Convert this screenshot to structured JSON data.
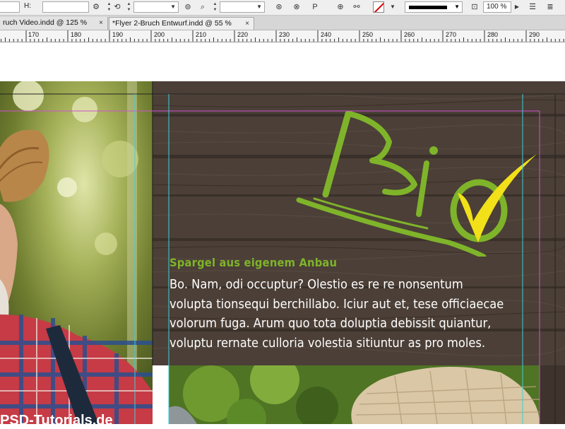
{
  "control_bar": {
    "height_label": "H:",
    "zoom_value": "100 %",
    "stroke_color": "#d40000"
  },
  "tabs": [
    {
      "label": "ruch Video.indd @ 125 %",
      "close": "×"
    },
    {
      "label": "*Flyer 2-Bruch Entwurf.indd @ 55 %",
      "close": "×"
    }
  ],
  "ruler": {
    "labels": [
      "170",
      "180",
      "190",
      "200",
      "210",
      "220",
      "230",
      "240",
      "250",
      "260",
      "270",
      "280",
      "290"
    ]
  },
  "document": {
    "headline": "Spargel aus eigenem Anbau",
    "body_lines": [
      "Bo. Nam, odi occuptur? Olestio es re re nonsentum",
      "volupta tionsequi berchillabo. Iciur aut et, tese officiaecae",
      "volorum fuga. Arum quo tota doluptia debissit quiantur,",
      "voluptu rernate culloria volestia sitiuntur as pro moles."
    ],
    "watermark": "PSD-Tutorials.de",
    "logo_text": "Bio",
    "colors": {
      "wood": "#4b3f37",
      "logo_green": "#7fb42a",
      "check_yellow": "#f2e019",
      "margin_guide": "#d04fd0",
      "column_guide": "#3ecfd6"
    }
  }
}
